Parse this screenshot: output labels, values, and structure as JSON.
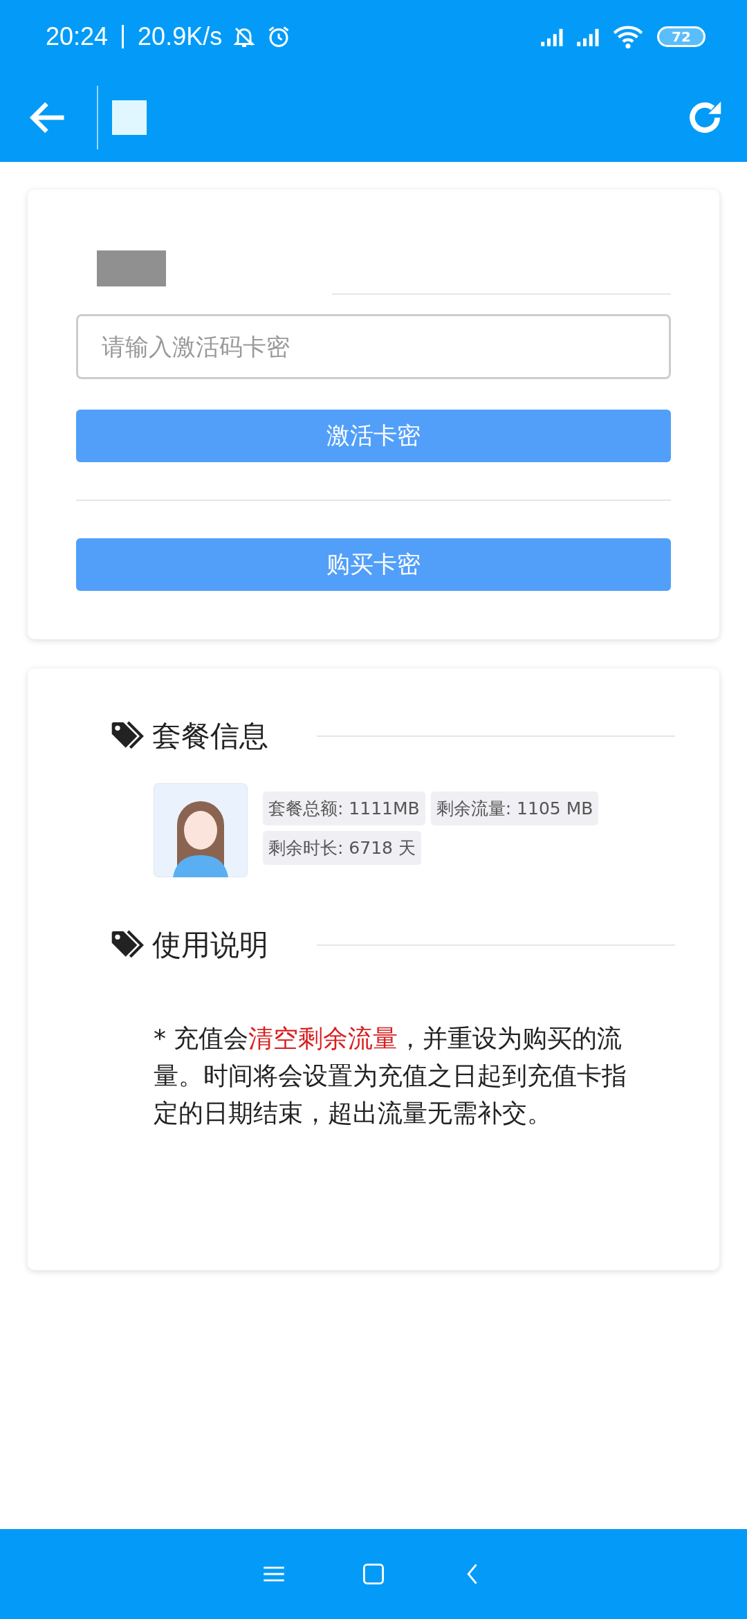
{
  "status_bar": {
    "time": "20:24",
    "speed": "20.9K/s",
    "battery": "72"
  },
  "activate_card": {
    "placeholder": "请输入激活码卡密",
    "activate_button": "激活卡密",
    "buy_button": "购买卡密"
  },
  "package_card": {
    "title": "套餐信息",
    "tags": [
      {
        "label": "套餐总额: 1111MB"
      },
      {
        "label": "剩余流量: 1105 MB"
      },
      {
        "label": "剩余时长: 6718 天"
      }
    ],
    "usage_title": "使用说明",
    "notice": [
      {
        "text": "* 充值会",
        "highlighted": false
      },
      {
        "text": "清空剩余流量",
        "highlighted": true
      },
      {
        "text": "，并重设为购买的流量。时间将会设置为充值之日起到充值卡指定的日期结束，超出流量无需补交。",
        "highlighted": false
      }
    ]
  }
}
